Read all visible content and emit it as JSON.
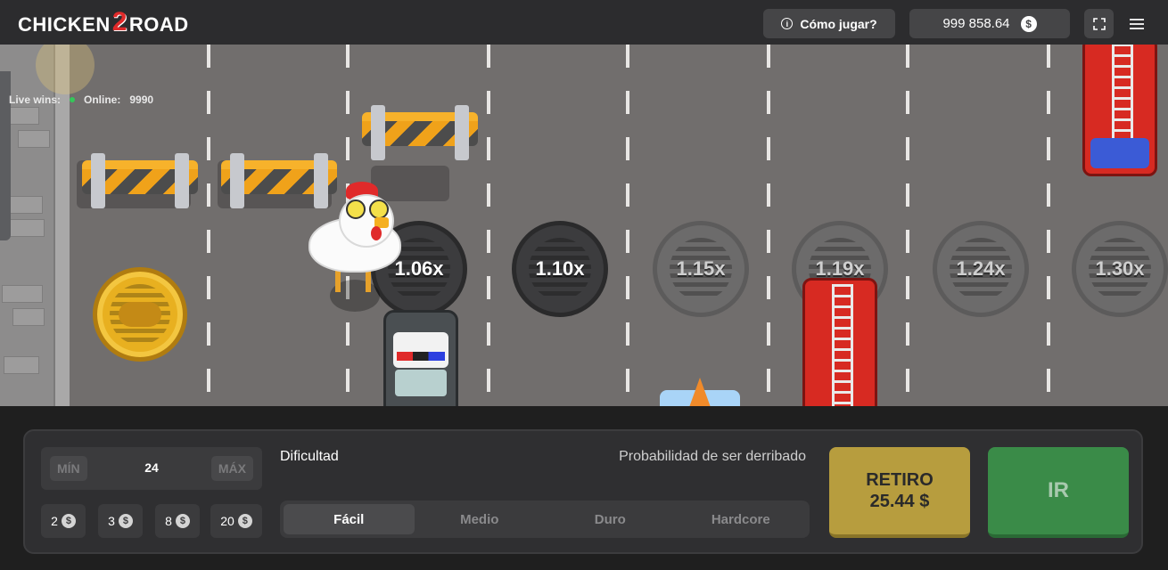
{
  "header": {
    "logo_text_a": "CHICKEN",
    "logo_text_num": "2",
    "logo_text_b": "ROAD",
    "how_to_play_label": "Cómo jugar?",
    "balance": "999 858.64",
    "currency_symbol": "$",
    "icons": [
      "info-icon",
      "coin-icon",
      "fullscreen-icon",
      "hamburger-menu-icon"
    ]
  },
  "live": {
    "live_wins_label": "Live wins:",
    "online_label": "Online:",
    "online_count": "9990",
    "online_dot_color": "#34c759"
  },
  "lanes": {
    "multipliers": [
      "1.06x",
      "1.10x",
      "1.15x",
      "1.19x",
      "1.24x",
      "1.30x"
    ]
  },
  "controls": {
    "bet": {
      "min_label": "MÍN",
      "max_label": "MÁX",
      "amount": "24"
    },
    "chips": [
      {
        "value": "2"
      },
      {
        "value": "3"
      },
      {
        "value": "8"
      },
      {
        "value": "20"
      }
    ],
    "difficulty_label": "Dificultad",
    "probability_label": "Probabilidad de ser derribado",
    "difficulty_options": [
      "Fácil",
      "Medio",
      "Duro",
      "Hardcore"
    ],
    "selected_difficulty": "Fácil",
    "cashout_label": "RETIRO",
    "cashout_amount": "25.44 $",
    "go_label": "IR",
    "colors": {
      "cashout": "#b79d3e",
      "go": "#3a8b48"
    }
  }
}
